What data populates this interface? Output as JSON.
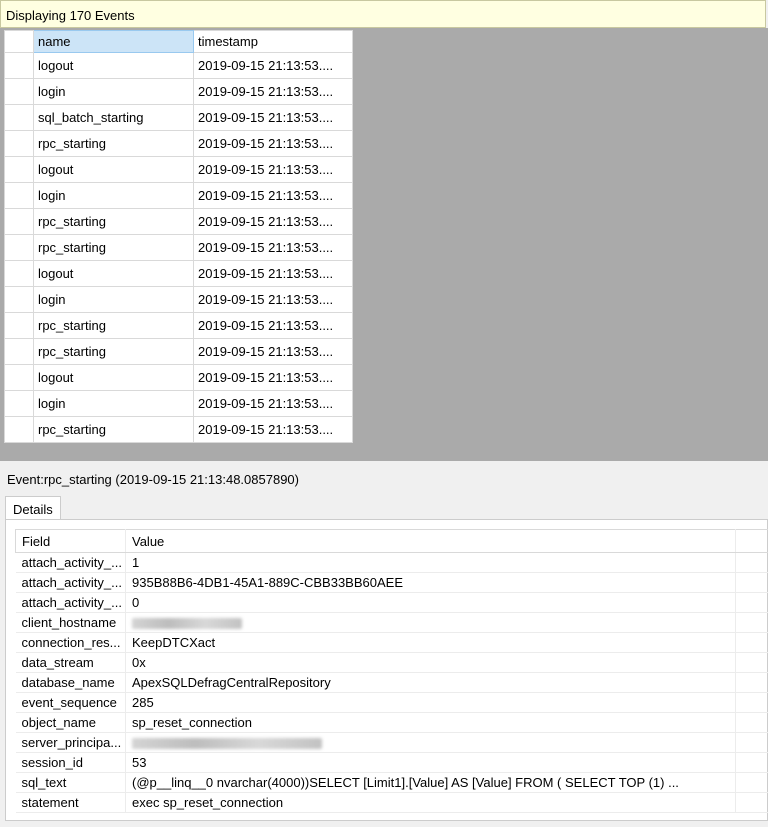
{
  "status": {
    "text": "Displaying 170 Events"
  },
  "grid": {
    "columns": [
      "name",
      "timestamp"
    ],
    "rows": [
      {
        "name": "logout",
        "timestamp": "2019-09-15 21:13:53...."
      },
      {
        "name": "login",
        "timestamp": "2019-09-15 21:13:53...."
      },
      {
        "name": "sql_batch_starting",
        "timestamp": "2019-09-15 21:13:53...."
      },
      {
        "name": "rpc_starting",
        "timestamp": "2019-09-15 21:13:53...."
      },
      {
        "name": "logout",
        "timestamp": "2019-09-15 21:13:53...."
      },
      {
        "name": "login",
        "timestamp": "2019-09-15 21:13:53...."
      },
      {
        "name": "rpc_starting",
        "timestamp": "2019-09-15 21:13:53...."
      },
      {
        "name": "rpc_starting",
        "timestamp": "2019-09-15 21:13:53...."
      },
      {
        "name": "logout",
        "timestamp": "2019-09-15 21:13:53...."
      },
      {
        "name": "login",
        "timestamp": "2019-09-15 21:13:53...."
      },
      {
        "name": "rpc_starting",
        "timestamp": "2019-09-15 21:13:53...."
      },
      {
        "name": "rpc_starting",
        "timestamp": "2019-09-15 21:13:53...."
      },
      {
        "name": "logout",
        "timestamp": "2019-09-15 21:13:53...."
      },
      {
        "name": "login",
        "timestamp": "2019-09-15 21:13:53...."
      },
      {
        "name": "rpc_starting",
        "timestamp": "2019-09-15 21:13:53...."
      }
    ]
  },
  "event_label": "Event:rpc_starting (2019-09-15 21:13:48.0857890)",
  "tabs": [
    {
      "label": "Details"
    }
  ],
  "details": {
    "headers": {
      "field": "Field",
      "value": "Value"
    },
    "rows": [
      {
        "field": "attach_activity_...",
        "value": "1"
      },
      {
        "field": "attach_activity_...",
        "value": "935B88B6-4DB1-45A1-889C-CBB33BB60AEE"
      },
      {
        "field": "attach_activity_...",
        "value": "0"
      },
      {
        "field": "client_hostname",
        "value": ""
      },
      {
        "field": "connection_res...",
        "value": "KeepDTCXact"
      },
      {
        "field": "data_stream",
        "value": "0x"
      },
      {
        "field": "database_name",
        "value": "ApexSQLDefragCentralRepository"
      },
      {
        "field": "event_sequence",
        "value": "285"
      },
      {
        "field": "object_name",
        "value": "sp_reset_connection"
      },
      {
        "field": "server_principa...",
        "value": ""
      },
      {
        "field": "session_id",
        "value": "53"
      },
      {
        "field": "sql_text",
        "value": "(@p__linq__0 nvarchar(4000))SELECT      [Limit1].[Value] AS [Value]      FROM ( SELECT TOP (1)    ..."
      },
      {
        "field": "statement",
        "value": "exec sp_reset_connection"
      }
    ]
  }
}
